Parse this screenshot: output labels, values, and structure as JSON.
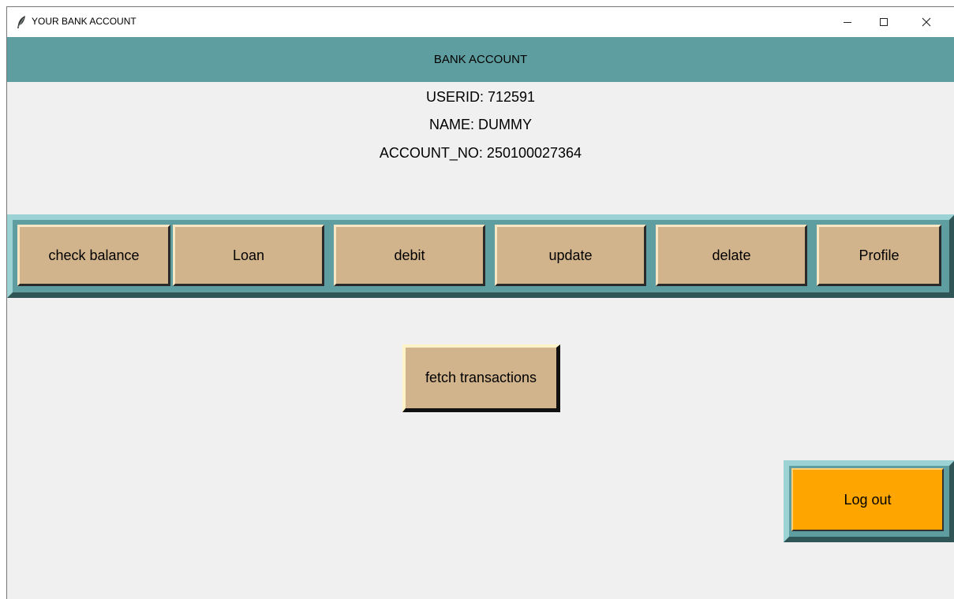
{
  "window": {
    "title": "YOUR BANK ACCOUNT",
    "icon": "feather-icon",
    "controls": {
      "minimize": "minimize-icon",
      "maximize": "maximize-icon",
      "close": "close-icon"
    }
  },
  "header": {
    "title": "BANK ACCOUNT",
    "background": "#5f9ea0"
  },
  "account": {
    "userid": "USERID: 712591",
    "name": "NAME: DUMMY",
    "account_no": "ACCOUNT_NO: 250100027364"
  },
  "toolbar": {
    "buttons": [
      {
        "label": "check balance"
      },
      {
        "label": "Loan"
      },
      {
        "label": "debit"
      },
      {
        "label": "update"
      },
      {
        "label": "delate"
      },
      {
        "label": "Profile"
      }
    ],
    "button_color": "#d2b48c"
  },
  "fetch": {
    "label": "fetch transactions"
  },
  "logout": {
    "label": "Log out",
    "color": "#ffa500"
  }
}
